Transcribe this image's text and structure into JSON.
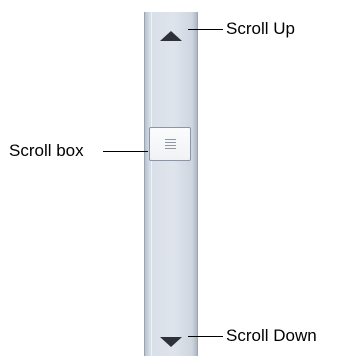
{
  "labels": {
    "scroll_up": "Scroll Up",
    "scroll_box": "Scroll box",
    "scroll_down": "Scroll Down"
  },
  "icons": {
    "up": "triangle-up-icon",
    "down": "triangle-down-icon",
    "grip": "grip-lines-icon"
  },
  "colors": {
    "track": "#dfe4ec",
    "arrow": "#2e3238",
    "thumb": "#f0f2f5",
    "line": "#000000"
  }
}
